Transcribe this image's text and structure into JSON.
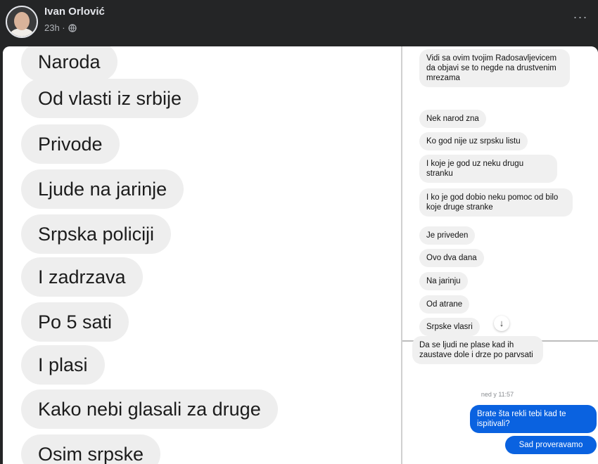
{
  "post": {
    "author": "Ivan Orlović",
    "time": "23h ·",
    "more_label": "···"
  },
  "left_messages": [
    "Naroda",
    "Od vlasti iz srbije",
    "Privode",
    "Ljude na jarinje",
    "Srpska policiji",
    "I zadrzava",
    "Po 5 sati",
    "I plasi",
    "Kako nebi glasali za druge",
    "Osim srpske"
  ],
  "right_top_messages": [
    "Vidi sa ovim tvojim Radosavljevicem da objavi se to negde na drustvenim mrezama",
    "Nek narod zna",
    "Ko god nije uz srpsku listu",
    "I koje je god uz neku drugu stranku",
    "I ko je god dobio neku pomoc od bilo koje druge stranke",
    "Je priveden",
    "Ovo dva dana",
    "Na jarinju",
    "Od atrane",
    "Srpske vlasri"
  ],
  "scroll_down_icon": "↓",
  "right_bottom": {
    "received": "Da se ljudi ne plase kad ih zaustave dole i drze po parvsati",
    "timestamp": "ned y 11:57",
    "sent": [
      "Brate šta rekli tebi kad te ispitivali?",
      "Sad proveravamo"
    ]
  },
  "colors": {
    "header_bg": "#242526",
    "sent_bubble": "#0a62e0",
    "received_bubble": "#f0f0f0"
  }
}
